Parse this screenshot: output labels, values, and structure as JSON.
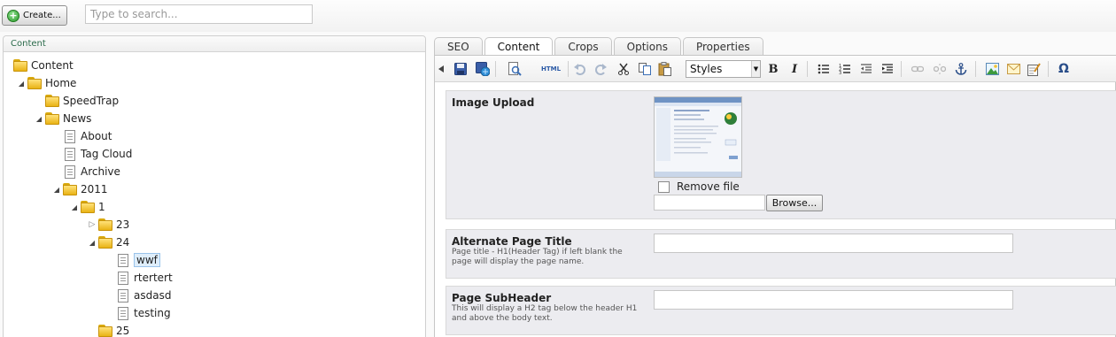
{
  "toolbar": {
    "create_label": "Create..."
  },
  "search": {
    "placeholder": "Type to search..."
  },
  "tree": {
    "header": "Content",
    "nodes": {
      "content": "Content",
      "home": "Home",
      "speedtrap": "SpeedTrap",
      "news": "News",
      "about": "About",
      "tagcloud": "Tag Cloud",
      "archive": "Archive",
      "y2011": "2011",
      "m1": "1",
      "d23": "23",
      "d24": "24",
      "wwf": "wwf",
      "rtertert": "rtertert",
      "asdasd": "asdasd",
      "testing": "testing",
      "d25": "25"
    }
  },
  "tabs": {
    "seo": "SEO",
    "content": "Content",
    "crops": "Crops",
    "options": "Options",
    "properties": "Properties"
  },
  "editor_toolbar": {
    "html": "HTML",
    "styles": "Styles",
    "bold": "B",
    "italic": "I",
    "omega": "Ω"
  },
  "image_upload": {
    "title": "Image Upload",
    "remove_label": "Remove file",
    "browse_label": "Browse..."
  },
  "alt_title": {
    "title": "Alternate Page Title",
    "desc": "Page title - H1(Header Tag) if left blank the page will display the page name."
  },
  "subheader": {
    "title": "Page SubHeader",
    "desc": "This will display a H2 tag below the header H1 and above the body text."
  },
  "colors": {
    "accent_green": "#2a6a4a",
    "folder_yellow": "#f2c230",
    "selection_blue": "#dfeefb"
  }
}
